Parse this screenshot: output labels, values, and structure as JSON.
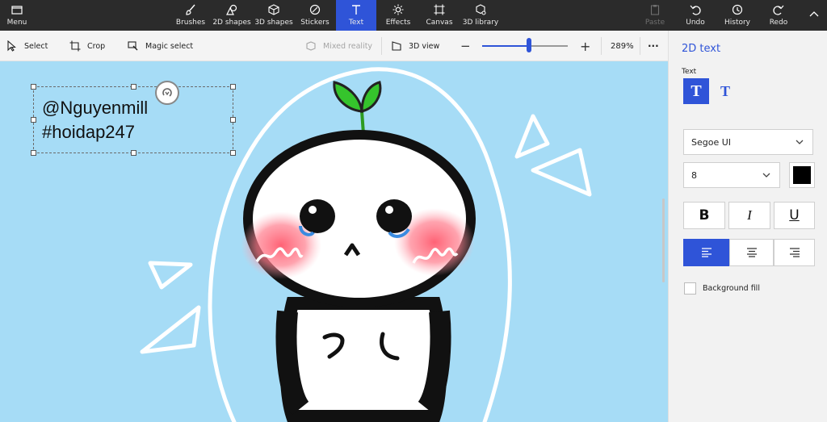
{
  "topbar": {
    "menu": "Menu",
    "tools": [
      {
        "label": "Brushes"
      },
      {
        "label": "2D shapes"
      },
      {
        "label": "3D shapes"
      },
      {
        "label": "Stickers"
      },
      {
        "label": "Text"
      },
      {
        "label": "Effects"
      },
      {
        "label": "Canvas"
      },
      {
        "label": "3D library"
      }
    ],
    "paste": "Paste",
    "undo": "Undo",
    "history": "History",
    "redo": "Redo"
  },
  "toolbar": {
    "select": "Select",
    "crop": "Crop",
    "magic_select": "Magic select",
    "mixed_reality": "Mixed reality",
    "view_3d": "3D view",
    "zoom_minus": "−",
    "zoom_plus": "+",
    "zoom_level": "289%",
    "more": "···",
    "zoom_fraction": 0.55
  },
  "canvas": {
    "text_line_1": "@Nguyenmill",
    "text_line_2": "#hoidap247",
    "background_color": "#a6dcf6"
  },
  "panel": {
    "title": "2D text",
    "text_label": "Text",
    "font_family": "Segoe UI",
    "font_size": "8",
    "text_color": "#000000",
    "bold": "B",
    "italic": "I",
    "underline": "U",
    "background_fill": "Background fill",
    "accent_color": "#2f54d8"
  }
}
